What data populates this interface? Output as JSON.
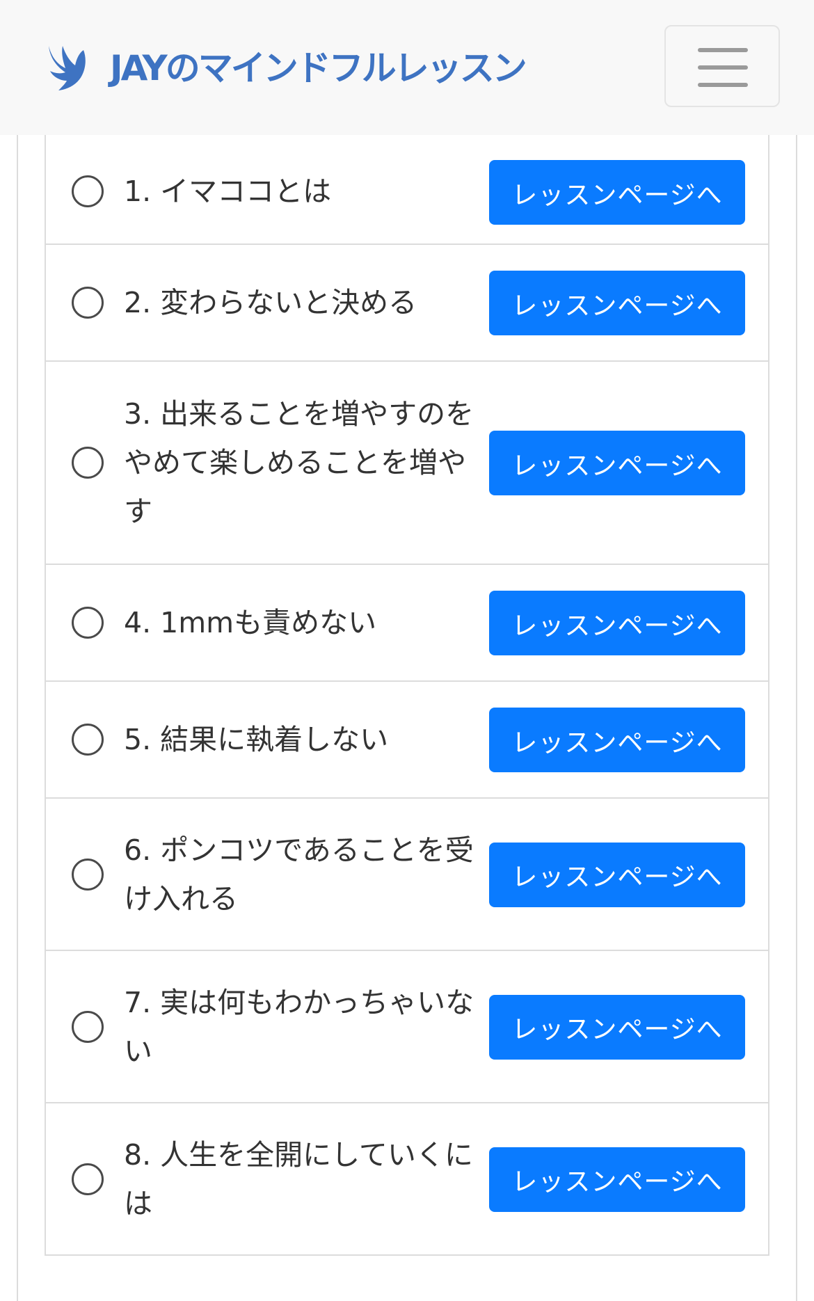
{
  "header": {
    "brand_name": "JAYのマインドフルレッスン",
    "logo_icon": "bird-icon",
    "menu_icon": "hamburger-icon"
  },
  "colors": {
    "brand": "#3e73c2",
    "button": "#0a7bff",
    "header_bg": "#f8f8f8",
    "border": "#dcdcdc"
  },
  "lessons": [
    {
      "title": "1. イマココとは",
      "button_label": "レッスンページへ"
    },
    {
      "title": "2. 変わらないと決める",
      "button_label": "レッスンページへ"
    },
    {
      "title": "3. 出来ることを増やすのをやめて楽しめることを増やす",
      "button_label": "レッスンページへ"
    },
    {
      "title": "4. 1mmも責めない",
      "button_label": "レッスンページへ"
    },
    {
      "title": "5. 結果に執着しない",
      "button_label": "レッスンページへ"
    },
    {
      "title": "6. ポンコツであることを受け入れる",
      "button_label": "レッスンページへ"
    },
    {
      "title": "7. 実は何もわかっちゃいない",
      "button_label": "レッスンページへ"
    },
    {
      "title": "8. 人生を全開にしていくには",
      "button_label": "レッスンページへ"
    }
  ]
}
